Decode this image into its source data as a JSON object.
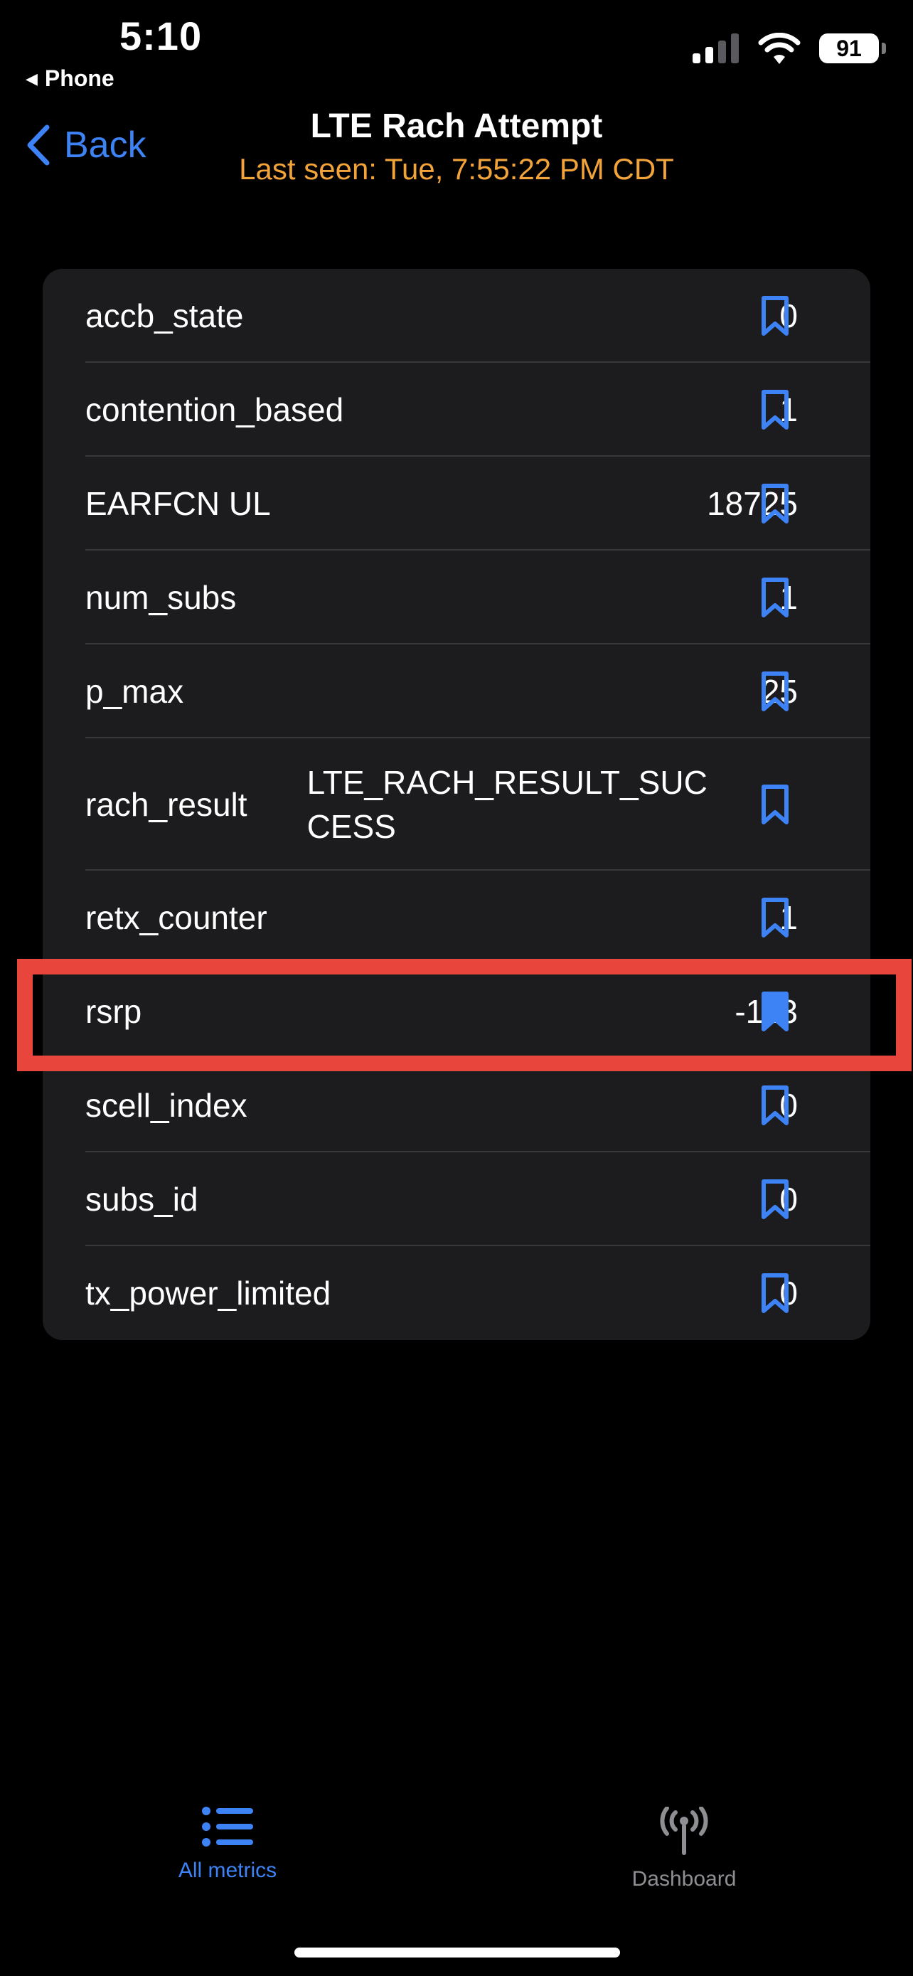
{
  "status_bar": {
    "time": "5:10",
    "back_app": "Phone",
    "battery": "91"
  },
  "nav": {
    "back_label": "Back",
    "title": "LTE Rach Attempt",
    "subtitle": "Last seen: Tue, 7:55:22 PM CDT"
  },
  "metrics": [
    {
      "label": "accb_state",
      "value": "0",
      "bookmarked": false
    },
    {
      "label": "contention_based",
      "value": "1",
      "bookmarked": false
    },
    {
      "label": "EARFCN UL",
      "value": "18725",
      "bookmarked": false
    },
    {
      "label": "num_subs",
      "value": "1",
      "bookmarked": false
    },
    {
      "label": "p_max",
      "value": "25",
      "bookmarked": false
    },
    {
      "label": "rach_result",
      "value": "LTE_RACH_RESULT_SUCCESS",
      "bookmarked": false
    },
    {
      "label": "retx_counter",
      "value": "1",
      "bookmarked": false
    },
    {
      "label": "rsrp",
      "value": "-113",
      "bookmarked": true
    },
    {
      "label": "scell_index",
      "value": "0",
      "bookmarked": false
    },
    {
      "label": "subs_id",
      "value": "0",
      "bookmarked": false
    },
    {
      "label": "tx_power_limited",
      "value": "0",
      "bookmarked": false
    }
  ],
  "tabs": [
    {
      "label": "All metrics",
      "icon": "list-icon",
      "active": true
    },
    {
      "label": "Dashboard",
      "icon": "antenna-icon",
      "active": false
    }
  ],
  "colors": {
    "accent": "#3d83f5",
    "subtitle": "#f2a33a",
    "highlight": "#e8463c",
    "card": "#1c1c1e"
  }
}
